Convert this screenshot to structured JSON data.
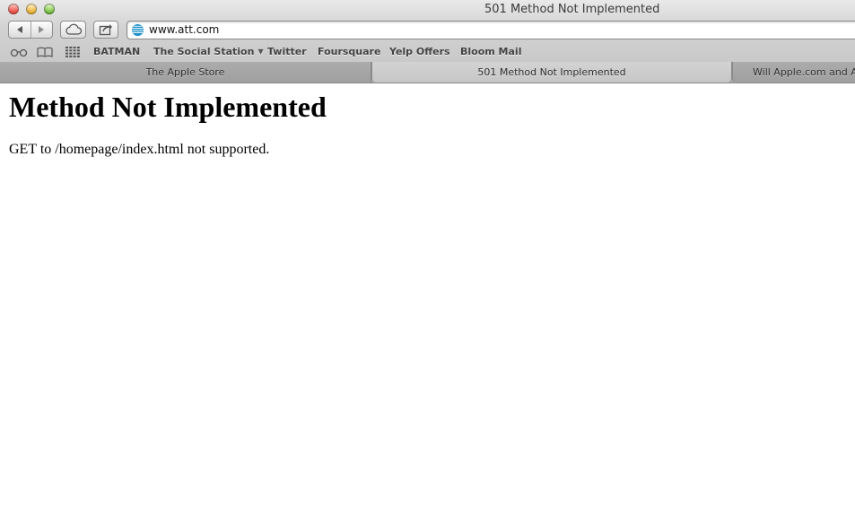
{
  "window": {
    "title": "501 Method Not Implemented"
  },
  "toolbar": {
    "address": {
      "url": "www.att.com",
      "site_icon": "att-globe-icon"
    },
    "icons": {
      "back": "back-arrow-icon",
      "forward": "forward-arrow-icon",
      "icloud": "icloud-icon",
      "share": "share-icon"
    }
  },
  "bookmarks": {
    "icons": [
      "reading-list-icon",
      "bookmarks-book-icon",
      "top-sites-grid-icon"
    ],
    "items": [
      {
        "label": "BATMAN"
      },
      {
        "label": "The Social Station",
        "has_menu": true
      },
      {
        "label": "Twitter"
      },
      {
        "label": "Foursquare"
      },
      {
        "label": "Yelp Offers"
      },
      {
        "label": "Bloom Mail"
      }
    ]
  },
  "tabs": [
    {
      "label": "The Apple Store",
      "active": false
    },
    {
      "label": "501 Method Not Implemented",
      "active": true
    },
    {
      "label": "Will Apple.com and A",
      "active": false
    }
  ],
  "page": {
    "heading": "Method Not Implemented",
    "message": "GET to /homepage/index.html not supported."
  },
  "colors": {
    "att_blue": "#1a8fc9",
    "close": "#e0443a",
    "minimize": "#e0a526",
    "zoom": "#62b034"
  }
}
